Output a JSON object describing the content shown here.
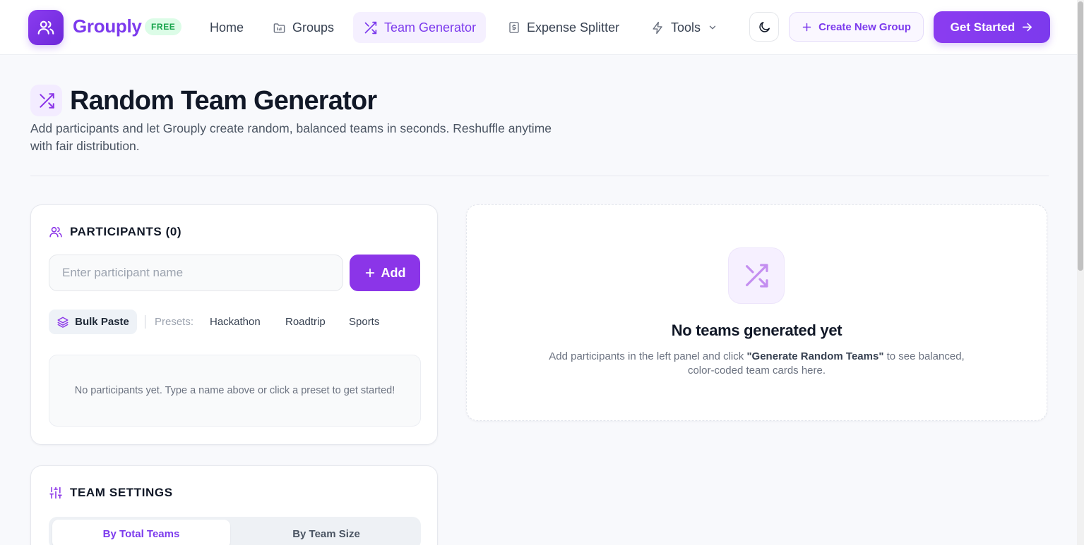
{
  "nav": {
    "brand": "Grouply",
    "badge": "FREE",
    "items": [
      {
        "label": "Home",
        "icon": "home"
      },
      {
        "label": "Groups",
        "icon": "folder-icon"
      },
      {
        "label": "Team Generator",
        "icon": "shuffle-icon",
        "active": true
      },
      {
        "label": "Expense Splitter",
        "icon": "receipt-icon"
      },
      {
        "label": "Tools",
        "icon": "lightning-icon"
      }
    ],
    "theme_toggle_icon": "moon-icon",
    "create_group_label": "Create New Group",
    "get_started_label": "Get Started"
  },
  "hero": {
    "title": "Random Team Generator",
    "description": "Add participants and let Grouply create random, balanced teams in seconds. Reshuffle anytime with fair distribution."
  },
  "participants": {
    "title": "PARTICIPANTS (0)",
    "input_placeholder": "Enter participant name",
    "input_value": "",
    "add_label": "Add",
    "bulk_paste_label": "Bulk Paste",
    "presets_label": "Presets:",
    "presets": [
      "Hackathon",
      "Roadtrip",
      "Sports"
    ],
    "empty_text": "No participants yet. Type a name above or click a preset to get started!"
  },
  "settings": {
    "title": "TEAM SETTINGS",
    "modes": [
      "By Total Teams",
      "By Team Size"
    ],
    "selected_mode": "By Total Teams"
  },
  "results": {
    "title": "No teams generated yet",
    "desc_before": "Add participants in the left panel and click ",
    "desc_strong": "\"Generate Random Teams\"",
    "desc_after": " to see balanced, color-coded team cards here."
  },
  "colors": {
    "accent": "#7c3aed",
    "accent_soft": "#f5f0ff",
    "badge_bg": "#dcfce7",
    "badge_text": "#16a34a"
  }
}
